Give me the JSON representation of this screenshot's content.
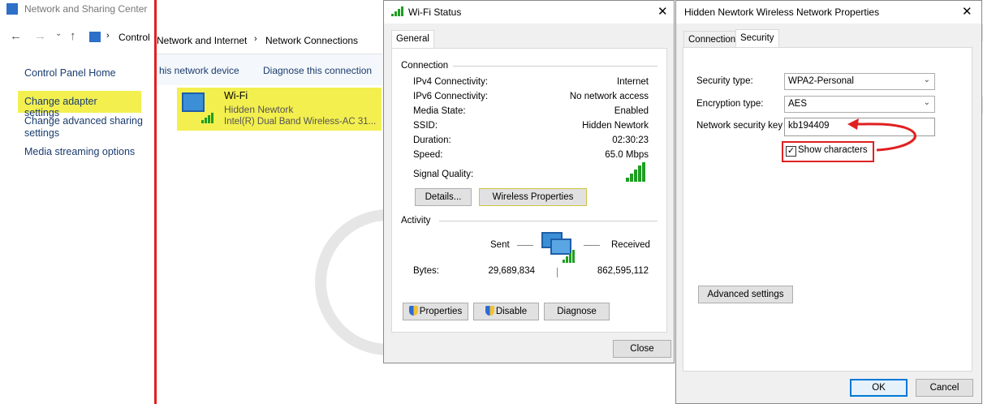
{
  "nsc": {
    "window_title": "Network and Sharing Center",
    "breadcrumb_control": "Control",
    "sidebar": [
      {
        "label": "Control Panel Home"
      },
      {
        "label": "Change adapter settings"
      },
      {
        "label": "Change advanced sharing settings"
      },
      {
        "label": "Media streaming options"
      }
    ]
  },
  "nc": {
    "breadcrumb": [
      "Network and Internet",
      "Network Connections"
    ],
    "toolbar": [
      "his network device",
      "Diagnose this connection"
    ],
    "adapter": {
      "name": "Wi-Fi",
      "network": "Hidden Newtork",
      "device": "Intel(R) Dual Band Wireless-AC 31..."
    }
  },
  "status": {
    "title": "Wi-Fi Status",
    "tab": "General",
    "connection_header": "Connection",
    "rows": [
      {
        "label": "IPv4 Connectivity:",
        "value": "Internet"
      },
      {
        "label": "IPv6 Connectivity:",
        "value": "No network access"
      },
      {
        "label": "Media State:",
        "value": "Enabled"
      },
      {
        "label": "SSID:",
        "value": "Hidden Newtork"
      },
      {
        "label": "Duration:",
        "value": "02:30:23"
      },
      {
        "label": "Speed:",
        "value": "65.0 Mbps"
      }
    ],
    "signal_label": "Signal Quality:",
    "details_btn": "Details...",
    "wireless_props_btn": "Wireless Properties",
    "activity_header": "Activity",
    "sent_label": "Sent",
    "received_label": "Received",
    "bytes_label": "Bytes:",
    "bytes_sent": "29,689,834",
    "bytes_received": "862,595,112",
    "properties_btn": "Properties",
    "disable_btn": "Disable",
    "diagnose_btn": "Diagnose",
    "close_btn": "Close"
  },
  "props": {
    "title": "Hidden Newtork Wireless Network Properties",
    "tabs": [
      "Connection",
      "Security"
    ],
    "security_type_label": "Security type:",
    "security_type": "WPA2-Personal",
    "encryption_label": "Encryption type:",
    "encryption": "AES",
    "key_label": "Network security key",
    "key_value": "kb194409",
    "show_chars": "Show characters",
    "advanced_btn": "Advanced settings",
    "ok_btn": "OK",
    "cancel_btn": "Cancel"
  },
  "colors": {
    "highlight": "#f3ef4f",
    "annotation": "#e02020",
    "signal": "#1f9e23"
  }
}
